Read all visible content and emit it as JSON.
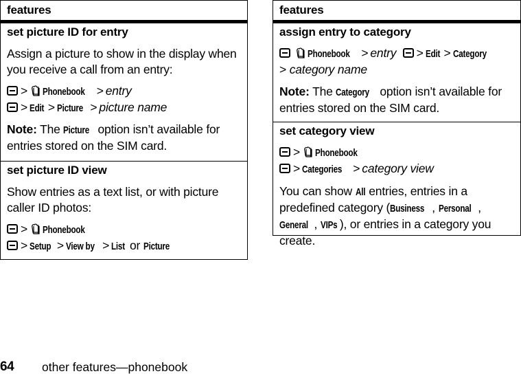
{
  "left_table": {
    "header": "features",
    "rows": [
      {
        "title": "set picture ID for entry",
        "description": "Assign a picture to show in the display when you receive a call from an entry:",
        "path_line1": {
          "phonebook": "Phonebook",
          "entry": "entry"
        },
        "path_line2": {
          "edit": "Edit",
          "picture": "Picture",
          "picture_name": "picture name"
        },
        "note": {
          "label": "Note:",
          "pre": "The",
          "keyword": "Picture",
          "post": "option isn’t available for entries stored on the SIM card."
        }
      },
      {
        "title": "set picture ID view",
        "description": "Show entries as a text list, or with picture caller ID photos:",
        "path_line1": {
          "phonebook": "Phonebook"
        },
        "path_line2": {
          "setup": "Setup",
          "view_by": "View by",
          "list": "List",
          "or": "or",
          "picture": "Picture"
        }
      }
    ]
  },
  "right_table": {
    "header": "features",
    "rows": [
      {
        "title": "assign entry to category",
        "path_line1": {
          "phonebook": "Phonebook",
          "entry": "entry",
          "edit": "Edit",
          "category": "Category"
        },
        "path_line2": {
          "category_name": "category name"
        },
        "note": {
          "label": "Note:",
          "pre": "The",
          "keyword": "Category",
          "post": "option isn’t available for entries stored on the SIM card."
        }
      },
      {
        "title": "set category view",
        "path_line1": {
          "phonebook": "Phonebook"
        },
        "path_line2": {
          "categories": "Categories",
          "category_view": "category view"
        },
        "description": {
          "pre": "You can show",
          "all": "All",
          "mid": "entries, entries in a predefined category (",
          "business": "Business",
          "personal": "Personal",
          "general": "General",
          "vips": "VIPs",
          "post": "), or entries in a category you create."
        }
      }
    ]
  },
  "symbols": {
    "gt": ">",
    "comma": ","
  },
  "icons": {
    "menu_key": "menu-key-icon",
    "phonebook": "phonebook-icon"
  },
  "footer": {
    "page_number": "64",
    "section": "other features—phonebook"
  }
}
